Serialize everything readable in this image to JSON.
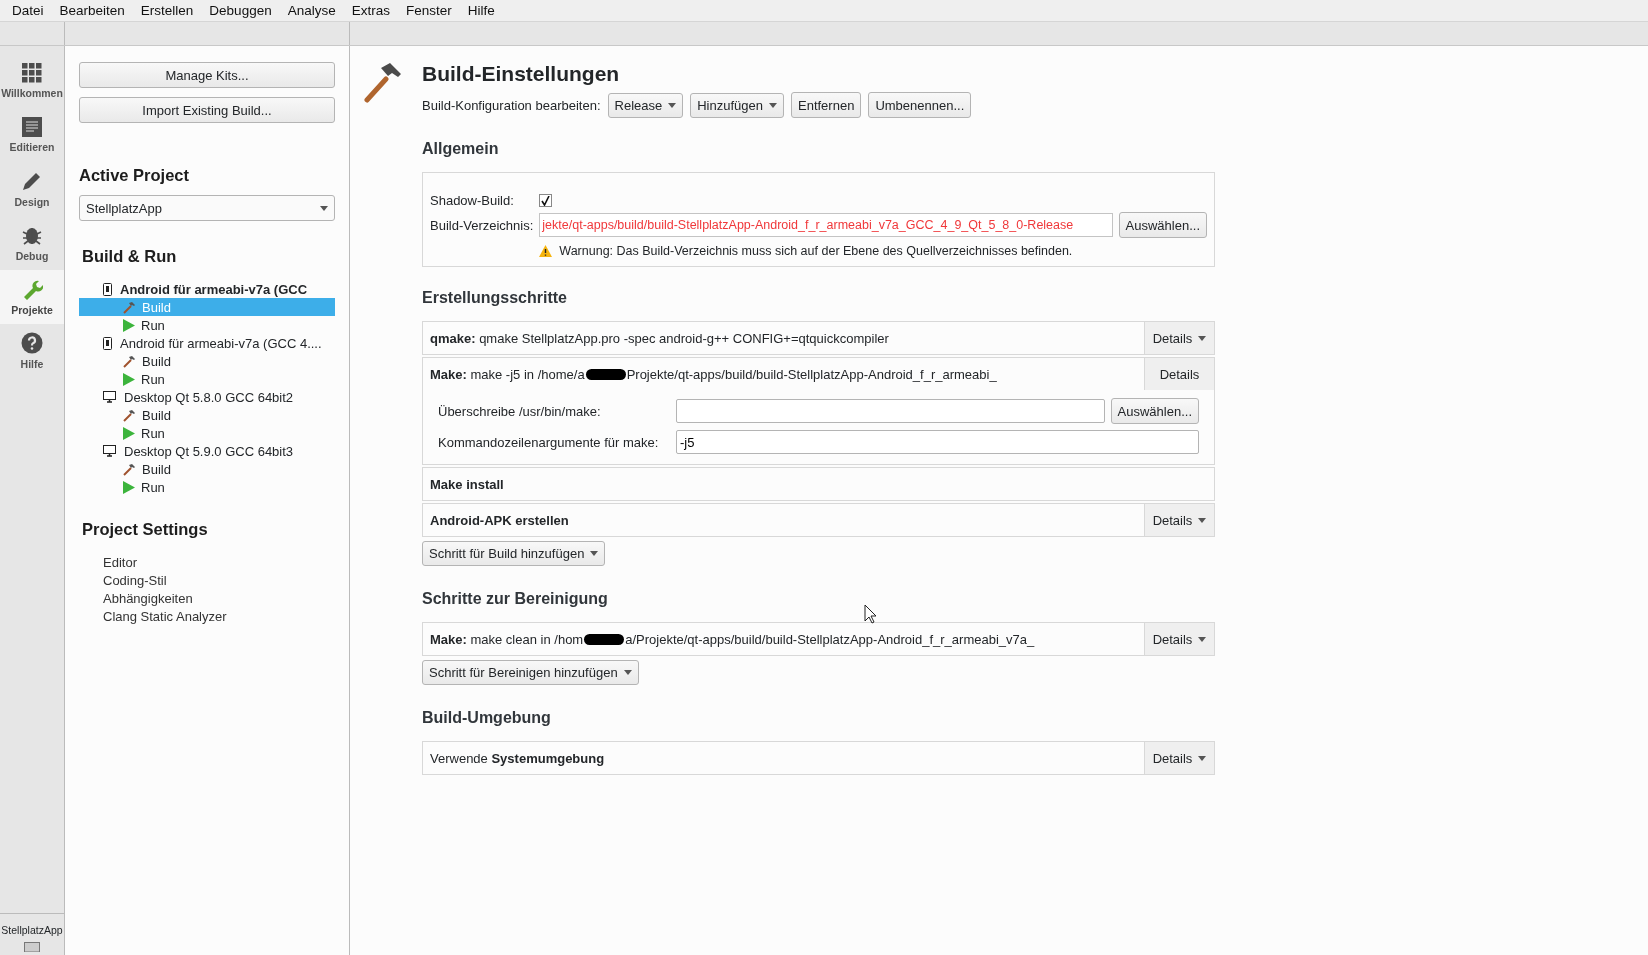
{
  "menu": [
    "Datei",
    "Bearbeiten",
    "Erstellen",
    "Debuggen",
    "Analyse",
    "Extras",
    "Fenster",
    "Hilfe"
  ],
  "modes": [
    {
      "label": "Willkommen",
      "kind": "grid",
      "selected": false
    },
    {
      "label": "Editieren",
      "kind": "document",
      "selected": false
    },
    {
      "label": "Design",
      "kind": "pencil",
      "selected": false
    },
    {
      "label": "Debug",
      "kind": "bug",
      "selected": false
    },
    {
      "label": "Projekte",
      "kind": "wrench",
      "selected": true
    },
    {
      "label": "Hilfe",
      "kind": "help",
      "selected": false
    }
  ],
  "mode_bottom": {
    "project": "StellplatzApp"
  },
  "project_panel": {
    "buttons": [
      "Manage Kits...",
      "Import Existing Build..."
    ],
    "active_project": {
      "heading": "Active Project",
      "value": "StellplatzApp"
    },
    "build_run": {
      "heading": "Build & Run",
      "kits": [
        {
          "name": "Android für armeabi-v7a (GCC",
          "kind": "phone",
          "active": true,
          "children": [
            {
              "label": "Build",
              "kind": "build",
              "selected": true
            },
            {
              "label": "Run",
              "kind": "run",
              "selected": false
            }
          ]
        },
        {
          "name": "Android für armeabi-v7a (GCC 4....",
          "kind": "phone",
          "active": false,
          "children": [
            {
              "label": "Build",
              "kind": "build",
              "selected": false
            },
            {
              "label": "Run",
              "kind": "run",
              "selected": false
            }
          ]
        },
        {
          "name": "Desktop Qt 5.8.0 GCC 64bit2",
          "kind": "desktop",
          "active": false,
          "children": [
            {
              "label": "Build",
              "kind": "build",
              "selected": false
            },
            {
              "label": "Run",
              "kind": "run",
              "selected": false
            }
          ]
        },
        {
          "name": "Desktop Qt 5.9.0 GCC 64bit3",
          "kind": "desktop",
          "active": false,
          "children": [
            {
              "label": "Build",
              "kind": "build",
              "selected": false
            },
            {
              "label": "Run",
              "kind": "run",
              "selected": false
            }
          ]
        }
      ]
    },
    "project_settings": {
      "heading": "Project Settings",
      "items": [
        "Editor",
        "Coding-Stil",
        "Abhängigkeiten",
        "Clang Static Analyzer"
      ]
    }
  },
  "main": {
    "title": "Build-Einstellungen",
    "config": {
      "label": "Build-Konfiguration bearbeiten:",
      "dropdowns": [
        "Release",
        "Hinzufügen"
      ],
      "buttons": [
        "Entfernen",
        "Umbenennen..."
      ]
    },
    "general": {
      "heading": "Allgemein",
      "shadow_label": "Shadow-Build:",
      "shadow_checked": true,
      "dir_label": "Build-Verzeichnis:",
      "dir_value": "jekte/qt-apps/build/build-StellplatzApp-Android_f_r_armeabi_v7a_GCC_4_9_Qt_5_8_0-Release",
      "dir_invalid": true,
      "browse": "Auswählen...",
      "warning": "Warnung: Das Build-Verzeichnis muss sich auf der Ebene des Quellverzeichnisses befinden."
    },
    "build_steps": {
      "heading": "Erstellungsschritte",
      "steps": [
        {
          "label": "qmake:",
          "summary": "qmake StellplatzApp.pro -spec android-g++ CONFIG+=qtquickcompiler",
          "details": "Details"
        },
        {
          "label": "Make:",
          "summary": "make -j5 in /home/a",
          "summary_rest": "Projekte/qt-apps/build/build-StellplatzApp-Android_f_r_armeabi_",
          "details": "Details",
          "fields": [
            {
              "label": "Überschreibe /usr/bin/make:",
              "button": "Auswählen..."
            },
            {
              "label": "Kommandozeilenargumente für make:",
              "value": "-j5"
            }
          ]
        },
        {
          "label": "Make install"
        },
        {
          "label": "Android-APK erstellen",
          "details": "Details"
        }
      ],
      "add": "Schritt für Build hinzufügen"
    },
    "clean_steps": {
      "heading": "Schritte zur Bereinigung",
      "steps": [
        {
          "label": "Make:",
          "summary": "make clean in /hom",
          "summary_rest": "a/Projekte/qt-apps/build/build-StellplatzApp-Android_f_r_armeabi_v7a_",
          "details": "Details"
        }
      ],
      "add": "Schritt für Bereinigen hinzufügen"
    },
    "environment": {
      "heading": "Build-Umgebung",
      "text": "Verwende **Systemumgebung**",
      "details": "Details"
    }
  }
}
